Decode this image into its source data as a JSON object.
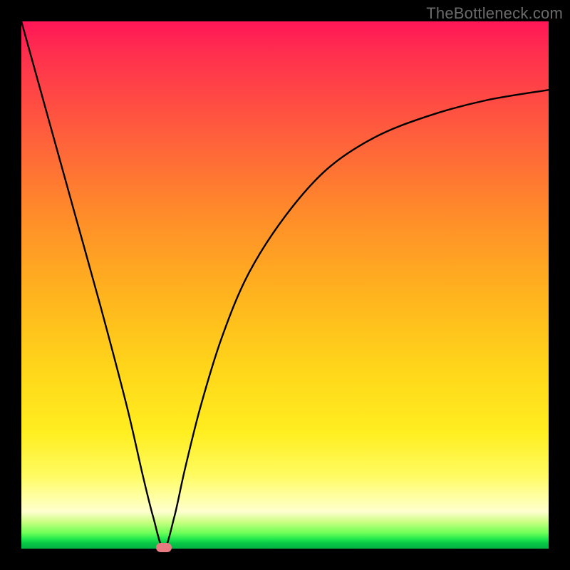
{
  "watermark": "TheBottleneck.com",
  "colors": {
    "frame": "#000000",
    "curve": "#000000",
    "marker": "#e87b82"
  },
  "chart_data": {
    "type": "line",
    "title": "",
    "xlabel": "",
    "ylabel": "",
    "xlim": [
      0,
      100
    ],
    "ylim": [
      0,
      100
    ],
    "grid": false,
    "legend": false,
    "note": "Background encodes quality: green (low y) = good, red (high y) = bad. Curve shows bottleneck % vs component axis; minimum near x≈27.",
    "series": [
      {
        "name": "bottleneck-curve",
        "x": [
          0,
          5,
          10,
          15,
          20,
          23,
          25,
          27,
          29,
          31,
          34,
          38,
          43,
          50,
          58,
          67,
          77,
          88,
          100
        ],
        "y": [
          100,
          82,
          64,
          46,
          27,
          14,
          6,
          0,
          6,
          15,
          27,
          40,
          52,
          63,
          72,
          78,
          82,
          85,
          87
        ]
      }
    ],
    "marker": {
      "x": 27,
      "y": 0
    }
  }
}
